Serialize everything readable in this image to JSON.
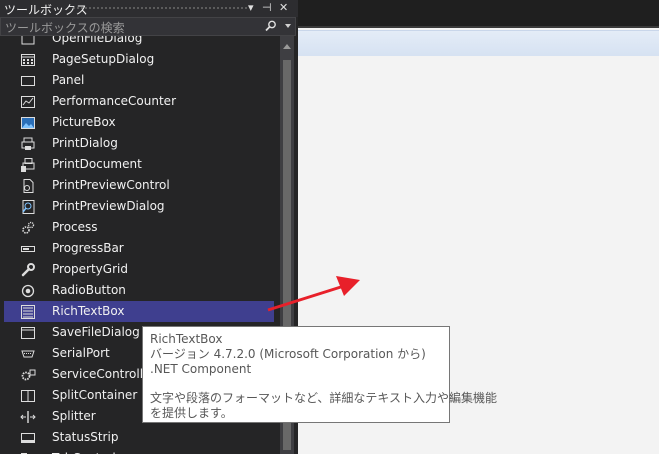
{
  "toolbox": {
    "title": "ツールボックス",
    "pin_glyph": "⊣",
    "close_glyph": "✕",
    "search_placeholder": "ツールボックスの検索",
    "items": [
      {
        "label": "OpenFileDialog",
        "icon": "open-file-dialog-icon"
      },
      {
        "label": "PageSetupDialog",
        "icon": "page-setup-dialog-icon"
      },
      {
        "label": "Panel",
        "icon": "panel-icon"
      },
      {
        "label": "PerformanceCounter",
        "icon": "performance-counter-icon"
      },
      {
        "label": "PictureBox",
        "icon": "picture-box-icon"
      },
      {
        "label": "PrintDialog",
        "icon": "print-dialog-icon"
      },
      {
        "label": "PrintDocument",
        "icon": "print-document-icon"
      },
      {
        "label": "PrintPreviewControl",
        "icon": "print-preview-control-icon"
      },
      {
        "label": "PrintPreviewDialog",
        "icon": "print-preview-dialog-icon"
      },
      {
        "label": "Process",
        "icon": "process-gear-icon"
      },
      {
        "label": "ProgressBar",
        "icon": "progress-bar-icon"
      },
      {
        "label": "PropertyGrid",
        "icon": "property-grid-wrench-icon"
      },
      {
        "label": "RadioButton",
        "icon": "radio-button-icon"
      },
      {
        "label": "RichTextBox",
        "icon": "rich-text-box-icon",
        "selected": true
      },
      {
        "label": "SaveFileDialog",
        "icon": "save-file-dialog-icon"
      },
      {
        "label": "SerialPort",
        "icon": "serial-port-icon"
      },
      {
        "label": "ServiceController",
        "icon": "service-controller-icon"
      },
      {
        "label": "SplitContainer",
        "icon": "split-container-icon"
      },
      {
        "label": "Splitter",
        "icon": "splitter-icon"
      },
      {
        "label": "StatusStrip",
        "icon": "status-strip-icon"
      },
      {
        "label": "TabControl",
        "icon": "tab-control-icon"
      }
    ]
  },
  "tooltip": {
    "name": "RichTextBox",
    "version": "バージョン 4.7.2.0 (Microsoft Corporation から)",
    "kind": ".NET Component",
    "description_line1": "文字や段落のフォーマットなど、詳細なテキスト入力や編集機能",
    "description_line2": "を提供します。"
  },
  "colors": {
    "selection": "#3f3f8f",
    "panel_bg": "#252526",
    "arrow": "#e8202a"
  }
}
